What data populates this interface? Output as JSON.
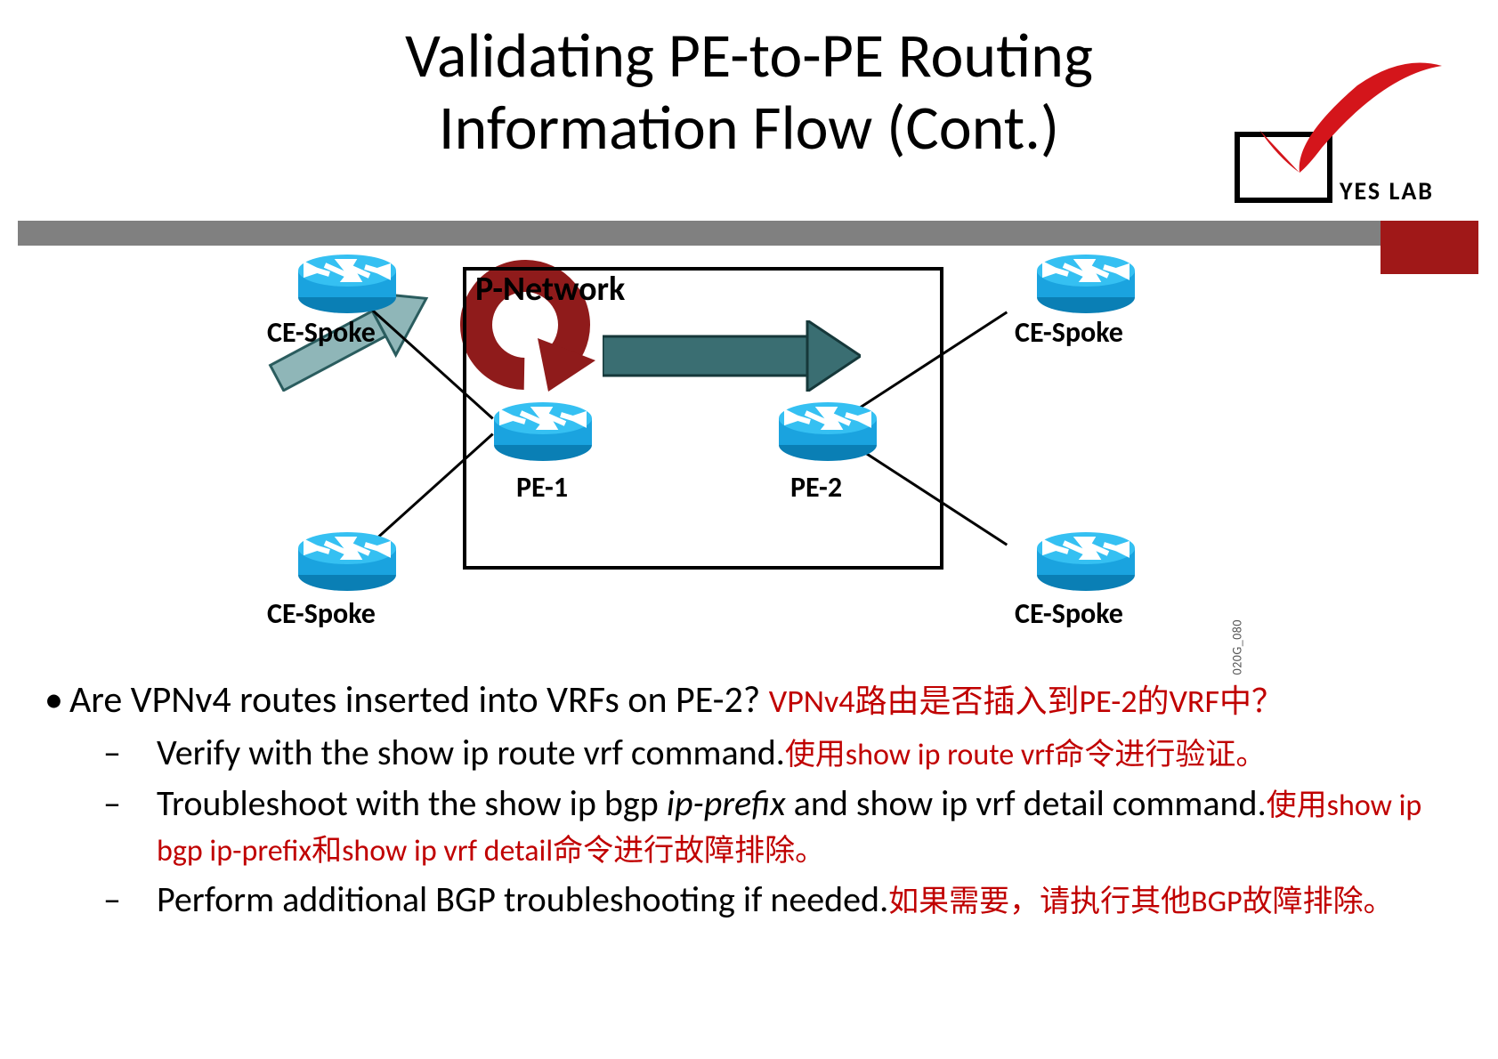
{
  "title_line1": "Validating PE-to-PE Routing",
  "title_line2": "Information Flow (Cont.)",
  "logo_text": "YES LAB",
  "diagram": {
    "pnet": "P-Network",
    "ce_spoke": "CE-Spoke",
    "pe1": "PE-1",
    "pe2": "PE-2",
    "img_id": "020G_080"
  },
  "bullet1_en": "Are VPNv4 routes inserted into VRFs on PE-2? ",
  "bullet1_zh": "VPNv4路由是否插入到PE-2的VRF中？",
  "sub1_en": "Verify with the show ip route vrf command.",
  "sub1_zh": "使用show ip route vrf命令进行验证。",
  "sub2_en_a": "Troubleshoot with the show ip bgp ",
  "sub2_en_i": "ip-prefix",
  "sub2_en_b": " and show ip  vrf detail command.",
  "sub2_zh": "使用show ip bgp ip-prefix和show ip vrf detail命令进行故障排除。",
  "sub3_en": "Perform additional BGP troubleshooting if needed.",
  "sub3_zh": "如果需要，请执行其他BGP故障排除。"
}
